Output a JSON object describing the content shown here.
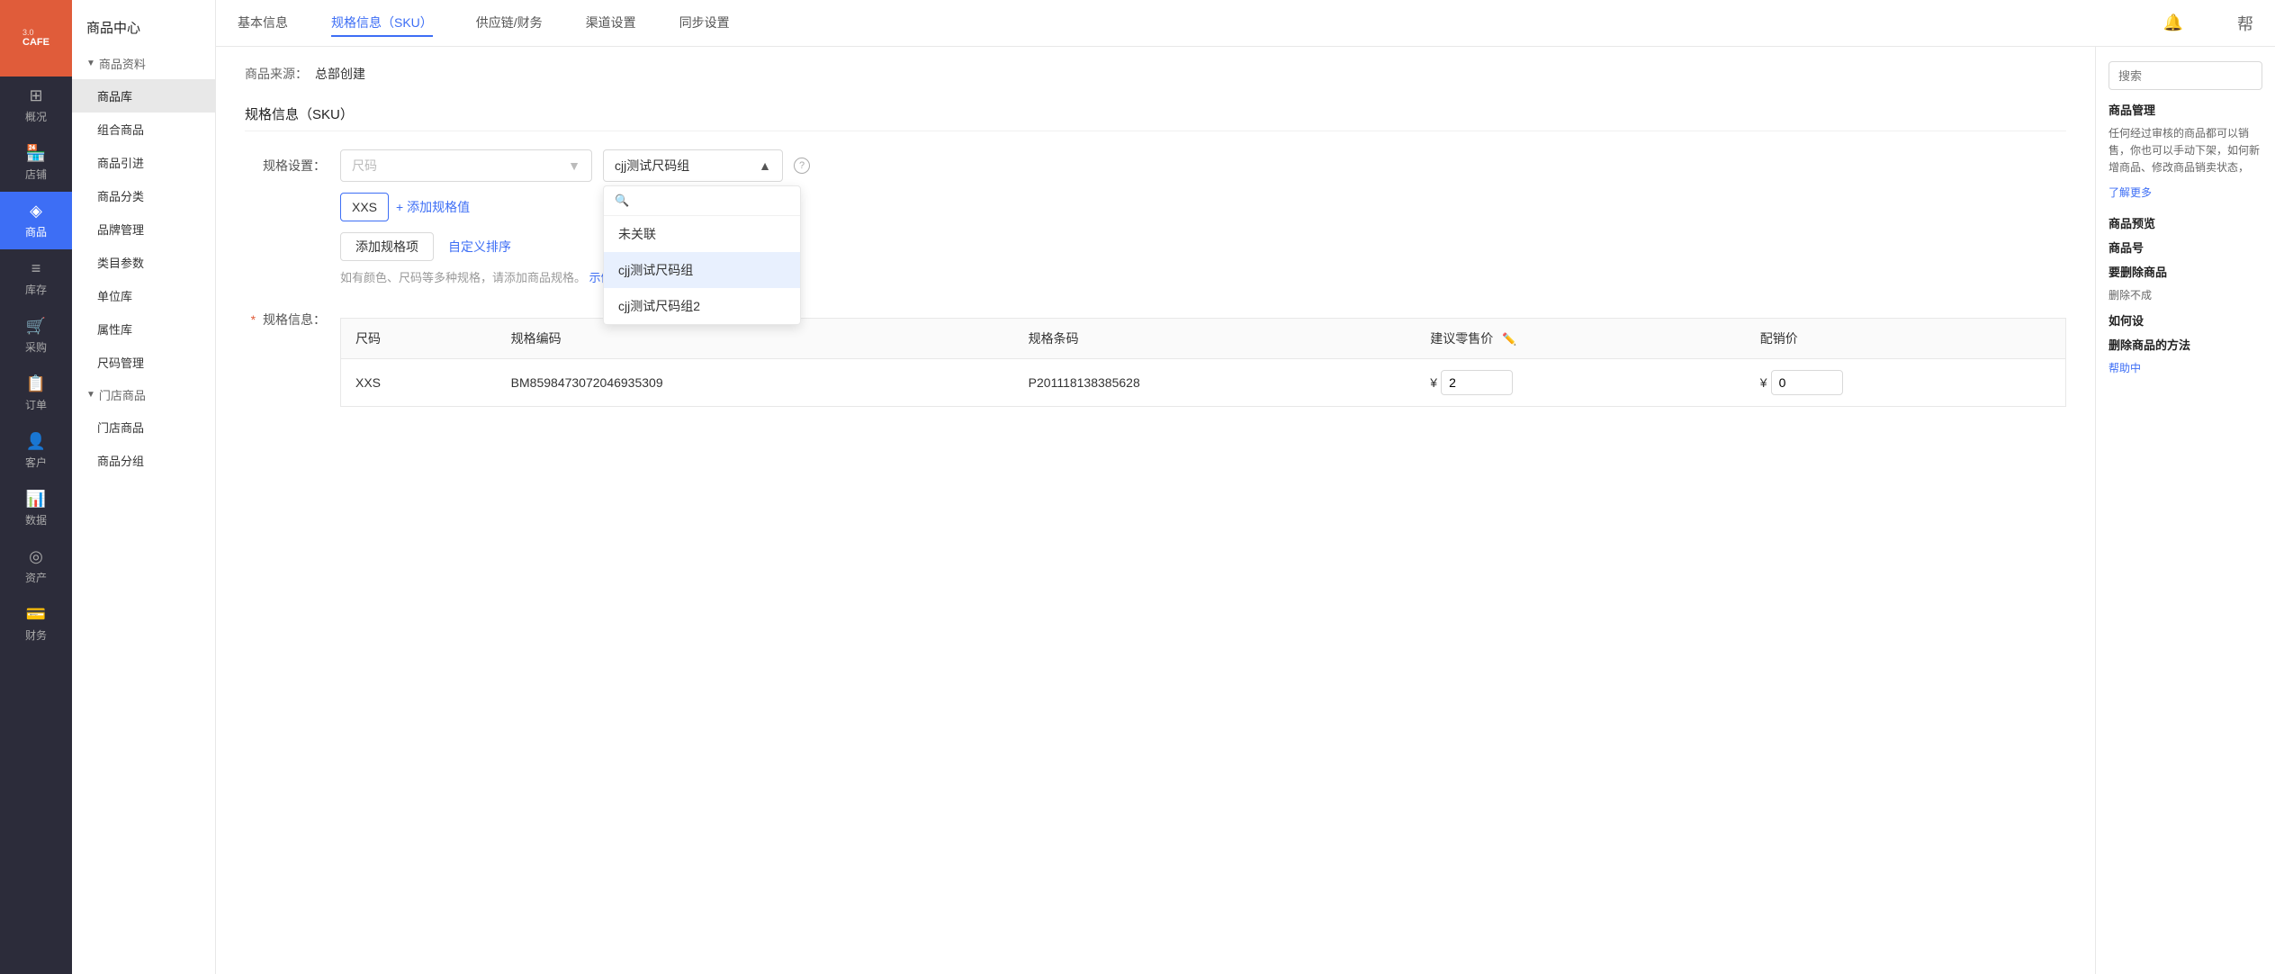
{
  "logo": {
    "version": "3.0",
    "name": "CAFE"
  },
  "sidebar": {
    "items": [
      {
        "id": "overview",
        "label": "概况",
        "icon": "☰"
      },
      {
        "id": "store",
        "label": "店铺",
        "icon": "🏪"
      },
      {
        "id": "product",
        "label": "商品",
        "icon": "📦",
        "active": true
      },
      {
        "id": "inventory",
        "label": "库存",
        "icon": "📋"
      },
      {
        "id": "purchase",
        "label": "采购",
        "icon": "🛒"
      },
      {
        "id": "order",
        "label": "订单",
        "icon": "📝"
      },
      {
        "id": "customer",
        "label": "客户",
        "icon": "👤"
      },
      {
        "id": "data",
        "label": "数据",
        "icon": "📊"
      },
      {
        "id": "asset",
        "label": "资产",
        "icon": "💰"
      },
      {
        "id": "finance",
        "label": "财务",
        "icon": "💳"
      }
    ]
  },
  "subSidebar": {
    "title": "商品中心",
    "sections": [
      {
        "label": "商品资料",
        "expanded": true,
        "items": [
          {
            "id": "product-lib",
            "label": "商品库",
            "active": true
          },
          {
            "id": "combo",
            "label": "组合商品"
          },
          {
            "id": "import",
            "label": "商品引进"
          },
          {
            "id": "category",
            "label": "商品分类"
          },
          {
            "id": "brand",
            "label": "品牌管理"
          },
          {
            "id": "type-params",
            "label": "类目参数"
          },
          {
            "id": "unit-lib",
            "label": "单位库"
          },
          {
            "id": "attr-lib",
            "label": "属性库"
          },
          {
            "id": "size-mgmt",
            "label": "尺码管理"
          }
        ]
      },
      {
        "label": "门店商品",
        "expanded": true,
        "items": [
          {
            "id": "store-product",
            "label": "门店商品"
          },
          {
            "id": "product-group",
            "label": "商品分组"
          }
        ]
      }
    ]
  },
  "topNav": {
    "items": [
      {
        "id": "basic",
        "label": "基本信息"
      },
      {
        "id": "sku",
        "label": "规格信息（SKU）",
        "active": true
      },
      {
        "id": "supply",
        "label": "供应链/财务"
      },
      {
        "id": "channel",
        "label": "渠道设置"
      },
      {
        "id": "sync",
        "label": "同步设置"
      }
    ]
  },
  "rightPanel": {
    "search": {
      "placeholder": "搜索"
    },
    "sections": [
      {
        "id": "product-mgmt",
        "title": "商品管理",
        "text": "任何经过审核的商品都可以销售，你也可以手动下架，如何新增商品、修改商品销卖状态，",
        "link": "了解更多"
      },
      {
        "id": "product-preview",
        "title": "商品预览"
      },
      {
        "id": "product-num",
        "title": "商品号"
      },
      {
        "id": "delete-product",
        "title": "要删除商品",
        "text": "删除不成"
      },
      {
        "id": "how-to",
        "title": "如何设"
      },
      {
        "id": "delete-method",
        "title": "删除商品的方法"
      },
      {
        "id": "help",
        "link": "帮助中"
      }
    ]
  },
  "form": {
    "source_label": "商品来源：",
    "source_value": "总部创建",
    "section_title": "规格信息（SKU）",
    "spec_setting_label": "规格设置：",
    "spec_placeholder": "尺码",
    "dropdown_selected": "cjj测试尺码组",
    "dropdown_arrow": "▲",
    "dropdown_items": [
      {
        "id": "unlinked",
        "label": "未关联"
      },
      {
        "id": "size-group-1",
        "label": "cjj测试尺码组",
        "selected": true
      },
      {
        "id": "size-group-2",
        "label": "cjj测试尺码组2"
      }
    ],
    "spec_tag": "XXS",
    "add_spec_value": "+ 添加规格值",
    "add_spec_item": "添加规格项",
    "custom_sort": "自定义排序",
    "hint": "如有颜色、尺码等多种规格，请添加商品规格。",
    "hint_link": "示例",
    "spec_info_label": "* 规格信息：",
    "required_star": "*",
    "table": {
      "columns": [
        {
          "id": "size",
          "label": "尺码"
        },
        {
          "id": "code",
          "label": "规格编码"
        },
        {
          "id": "barcode",
          "label": "规格条码"
        },
        {
          "id": "retail_price",
          "label": "建议零售价"
        },
        {
          "id": "distribution_price",
          "label": "配销价"
        }
      ],
      "rows": [
        {
          "size": "XXS",
          "code": "BM8598473072046935309",
          "barcode": "P201118138385628",
          "retail_price_symbol": "¥",
          "retail_price": "2",
          "distribution_price_symbol": "¥",
          "distribution_price": "0"
        }
      ]
    }
  }
}
